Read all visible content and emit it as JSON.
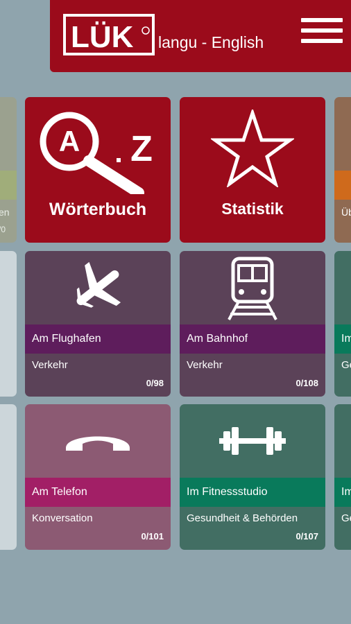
{
  "header": {
    "logo_text": "LÜK",
    "title": "langu - English",
    "menu_icon": "hamburger-menu-icon"
  },
  "tiles": [
    {
      "id": "dictionary",
      "label": "Wörterbuch",
      "icon": "a-z-magnifier-icon"
    },
    {
      "id": "statistics",
      "label": "Statistik",
      "icon": "star-icon"
    }
  ],
  "cards": [
    {
      "title": "Am Flughafen",
      "category": "Verkehr",
      "count": "0/98",
      "icon": "airplane-icon",
      "bg": "#5b4258",
      "band": "#5e1d5c"
    },
    {
      "title": "Am Bahnhof",
      "category": "Verkehr",
      "count": "0/108",
      "icon": "train-icon",
      "bg": "#5b4258",
      "band": "#5e1d5c"
    },
    {
      "title": "Am Telefon",
      "category": "Konversation",
      "count": "0/101",
      "icon": "telephone-icon",
      "bg": "#8c5a73",
      "band": "#a21f66"
    },
    {
      "title": "Im Fitnessstudio",
      "category": "Gesundheit & Behörden",
      "count": "0/107",
      "icon": "dumbbell-icon",
      "bg": "#426e63",
      "band": "#097a5b"
    }
  ],
  "partial_right": [
    {
      "title_fragment": "Im",
      "category_fragment": "Ge"
    },
    {
      "title_fragment": "Im",
      "category_fragment": "Ge"
    }
  ],
  "partial_right_top": {
    "title_fragment": "Üb"
  },
  "partial_left_top": {
    "text1": "en",
    "text2": "/0"
  },
  "colors": {
    "brand_red": "#9b0b1b",
    "background": "#8fa4ad"
  }
}
